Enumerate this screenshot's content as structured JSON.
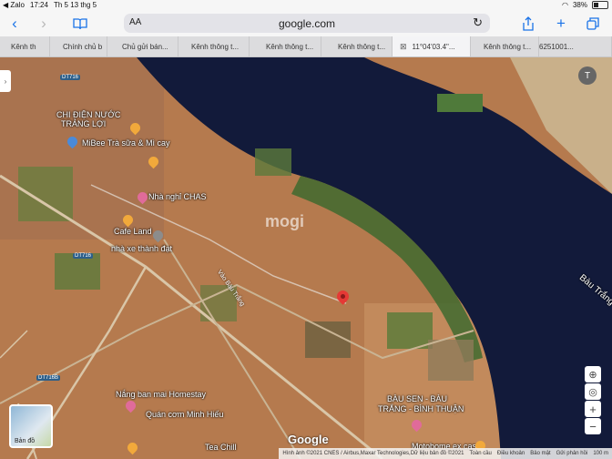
{
  "status_bar": {
    "carrier": "◀ Zalo",
    "time": "17:24",
    "date": "Th 5 13 thg 5",
    "battery": "38%"
  },
  "toolbar": {
    "text_size_label": "AA",
    "url_host": "google.com"
  },
  "tabs": [
    {
      "label": "Kênh th"
    },
    {
      "label": "Chính chủ b"
    },
    {
      "label": "Chủ gửi bán..."
    },
    {
      "label": "Kênh thông t..."
    },
    {
      "label": "Kênh thông t..."
    },
    {
      "label": "Kênh thông t..."
    },
    {
      "label": "11°04'03.4\"..."
    },
    {
      "label": "Kênh thông t..."
    },
    {
      "label": "6251001..."
    }
  ],
  "map": {
    "avatar_letter": "T",
    "watermark": "mogi",
    "place_labels": {
      "chi_dien_nuoc": "CHI ĐIỆN NƯỚC",
      "trang_loi": "TRẢNG LỢI",
      "mibee": "MiBee Trà sữa & Mì cay",
      "nha_nghi": "Nhà nghỉ CHAS",
      "cafe_land": "Cafe Land",
      "nha_xe": "nhà xe thành đạt",
      "bau_trang": "Bàu Trắng",
      "homestay": "Nắng ban mai Homestay",
      "quan_com": "Quán cơm Minh Hiếu",
      "bau_sen": "BÀU SEN - BÀU",
      "bau_sen2": "TRẮNG - BÌNH THUẬN",
      "motobome": "Motobome ex cas",
      "tea_chill": "Tea Chill"
    },
    "road_labels": {
      "dt716_a": "DT716",
      "dt716_b": "DT716",
      "dt716_c": "DT716B",
      "vao_bau_trang": "Vào Bàu Trắng"
    },
    "thumbnail_label": "Bản đồ",
    "google_logo": "Google",
    "attribution": "Hình ảnh ©2021 CNES / Airbus,Maxar Technologies,Dữ liệu bản đồ ©2021",
    "attrib_links": [
      "Toàn cầu",
      "Điều khoản",
      "Bảo mật",
      "Gửi phản hồi",
      "100 m"
    ],
    "colors": {
      "water": "#121a3a",
      "land": "#b57a4e",
      "vegetation": "#5a7a3a",
      "pin": "#e53935"
    }
  }
}
